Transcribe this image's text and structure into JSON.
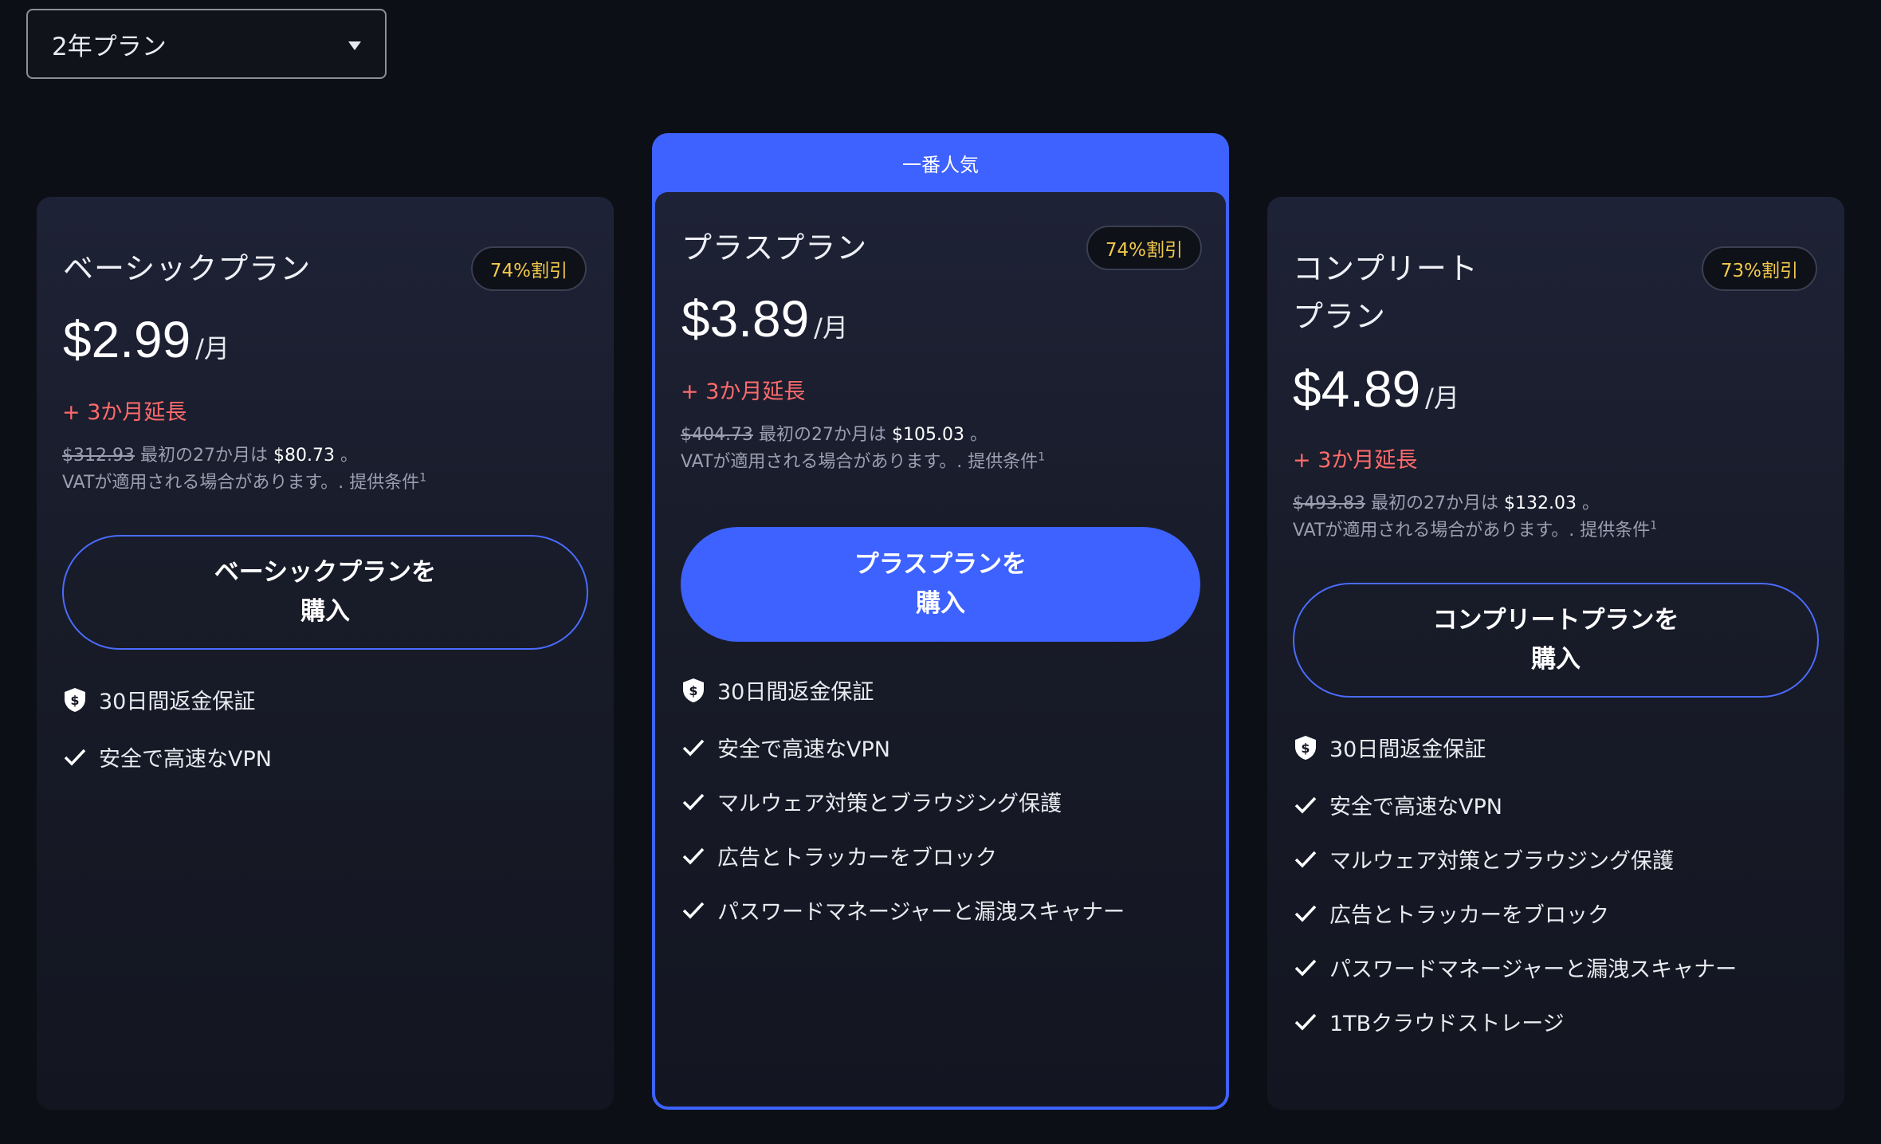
{
  "plan_selector": {
    "selected": "2年プラン"
  },
  "featured_label": "一番人気",
  "plans": [
    {
      "title_line1": "ベーシックプラン",
      "title_line2": "",
      "discount": "74%割引",
      "price": "$2.99",
      "per": "/月",
      "extension": "+ 3か月延長",
      "original_price": "$312.93",
      "first_period_text": "最初の27か月は",
      "first_period_price": "$80.73",
      "period_end": "。",
      "vat_text": "VATが適用される場合があります。. 提供条件",
      "footnote": "1",
      "button_label": "ベーシックプランを\n購入",
      "guarantee": "30日間返金保証",
      "features": [
        "安全で高速なVPN"
      ]
    },
    {
      "title_line1": "プラスプラン",
      "title_line2": "",
      "discount": "74%割引",
      "price": "$3.89",
      "per": "/月",
      "extension": "+ 3か月延長",
      "original_price": "$404.73",
      "first_period_text": "最初の27か月は",
      "first_period_price": "$105.03",
      "period_end": "。",
      "vat_text": "VATが適用される場合があります。. 提供条件",
      "footnote": "1",
      "button_label": "プラスプランを\n購入",
      "guarantee": "30日間返金保証",
      "features": [
        "安全で高速なVPN",
        "マルウェア対策とブラウジング保護",
        "広告とトラッカーをブロック",
        "パスワードマネージャーと漏洩スキャナー"
      ]
    },
    {
      "title_line1": "コンプリート",
      "title_line2": "プラン",
      "discount": "73%割引",
      "price": "$4.89",
      "per": "/月",
      "extension": "+ 3か月延長",
      "original_price": "$493.83",
      "first_period_text": "最初の27か月は",
      "first_period_price": "$132.03",
      "period_end": "。",
      "vat_text": "VATが適用される場合があります。. 提供条件",
      "footnote": "1",
      "button_label": "コンプリートプランを\n購入",
      "guarantee": "30日間返金保証",
      "features": [
        "安全で高速なVPN",
        "マルウェア対策とブラウジング保護",
        "広告とトラッカーをブロック",
        "パスワードマネージャーと漏洩スキャナー",
        "1TBクラウドストレージ"
      ]
    }
  ],
  "colors": {
    "accent": "#3d62ff",
    "extension": "#ff6b6b",
    "badge_text": "#f2c94c",
    "background": "#0d0f16"
  },
  "icons": {
    "guarantee": "shield-dollar-icon",
    "feature": "check-icon",
    "dropdown": "caret-down-icon"
  }
}
